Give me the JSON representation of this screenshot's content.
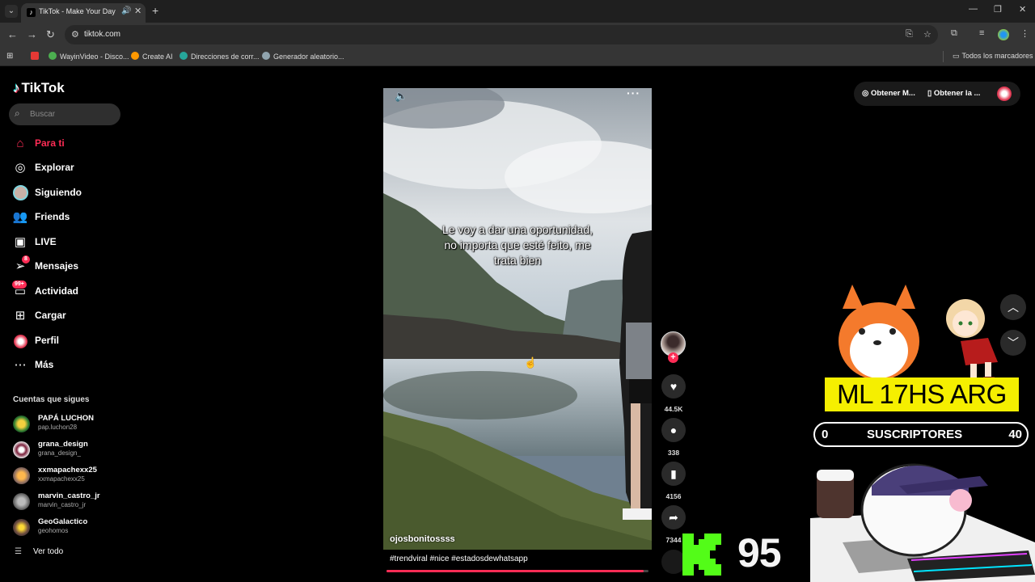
{
  "browser": {
    "tab_title": "TikTok - Make Your Day",
    "url": "tiktok.com",
    "bookmarks": [
      {
        "label": "",
        "color": "#e53935"
      },
      {
        "label": "WayinVideo - Disco...",
        "color": "#4caf50"
      },
      {
        "label": "Create AI",
        "color": "#ff9800"
      },
      {
        "label": "Direcciones de corr...",
        "color": "#26a69a"
      },
      {
        "label": "Generador aleatorio...",
        "color": "#90a4ae"
      }
    ],
    "all_bookmarks": "Todos los marcadores"
  },
  "sidebar": {
    "logo": "TikTok",
    "search_placeholder": "Buscar",
    "nav": [
      {
        "label": "Para ti",
        "icon": "home-icon",
        "active": true
      },
      {
        "label": "Explorar",
        "icon": "compass-icon"
      },
      {
        "label": "Siguiendo",
        "icon": "following-avatar-icon"
      },
      {
        "label": "Friends",
        "icon": "friends-icon"
      },
      {
        "label": "LIVE",
        "icon": "live-icon"
      },
      {
        "label": "Mensajes",
        "icon": "messages-icon",
        "badge": "8"
      },
      {
        "label": "Actividad",
        "icon": "activity-icon",
        "badge": "99+"
      },
      {
        "label": "Cargar",
        "icon": "upload-icon"
      },
      {
        "label": "Perfil",
        "icon": "profile-icon"
      },
      {
        "label": "Más",
        "icon": "more-icon"
      }
    ],
    "following_title": "Cuentas que sigues",
    "accounts": [
      {
        "name": "PAPÁ LUCHON",
        "handle": "pap.luchon28"
      },
      {
        "name": "grana_design",
        "handle": "grana_design_"
      },
      {
        "name": "xxmapachexx25",
        "handle": "xxmapachexx25"
      },
      {
        "name": "marvin_castro_jr",
        "handle": "marvin_castro_jr"
      },
      {
        "name": "GeoGalactico",
        "handle": "geohomos"
      }
    ],
    "see_all": "Ver todo"
  },
  "header": {
    "get_app": "Obtener M...",
    "get_desktop": "Obtener la ..."
  },
  "video": {
    "caption_overlay": "Le voy a dar una oportunidad, no importa que esté feito, me trata bien",
    "author": "ojosbonitossss",
    "hashtags": "#trendviral #nice #estadosdewhatsapp",
    "progress": 0.98,
    "likes": "44.5K",
    "comments": "338",
    "saves": "4156",
    "shares": "7344"
  },
  "overlay": {
    "banner": "ML 17HS ARG",
    "subs_left": "0",
    "subs_label": "SUSCRIPTORES",
    "subs_right": "40",
    "kick_count": "95",
    "banner_color": "#f5ef00",
    "kick_color": "#53fc18"
  }
}
